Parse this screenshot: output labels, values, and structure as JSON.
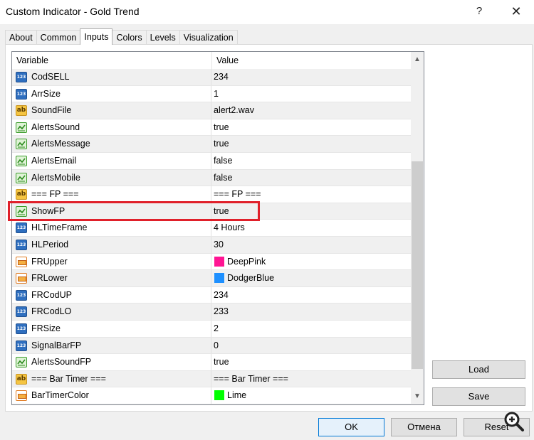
{
  "window": {
    "title": "Custom Indicator - Gold Trend",
    "help": "?",
    "close": "✕"
  },
  "tabs": [
    "About",
    "Common",
    "Inputs",
    "Colors",
    "Levels",
    "Visualization"
  ],
  "grid": {
    "headers": {
      "variable": "Variable",
      "value": "Value"
    },
    "rows": [
      {
        "type": "num",
        "name": "CodSELL",
        "value": "234"
      },
      {
        "type": "num",
        "name": "ArrSize",
        "value": "1"
      },
      {
        "type": "str",
        "name": "SoundFile",
        "value": "alert2.wav"
      },
      {
        "type": "bool",
        "name": "AlertsSound",
        "value": "true"
      },
      {
        "type": "bool",
        "name": "AlertsMessage",
        "value": "true"
      },
      {
        "type": "bool",
        "name": "AlertsEmail",
        "value": "false"
      },
      {
        "type": "bool",
        "name": "AlertsMobile",
        "value": "false"
      },
      {
        "type": "str",
        "name": "=== FP ===",
        "value": "=== FP ==="
      },
      {
        "type": "bool",
        "name": "ShowFP",
        "value": "true"
      },
      {
        "type": "num",
        "name": "HLTimeFrame",
        "value": "4 Hours"
      },
      {
        "type": "num",
        "name": "HLPeriod",
        "value": "30"
      },
      {
        "type": "color",
        "name": "FRUpper",
        "value": "DeepPink",
        "swatch": "#ff1493"
      },
      {
        "type": "color",
        "name": "FRLower",
        "value": "DodgerBlue",
        "swatch": "#1e90ff"
      },
      {
        "type": "num",
        "name": "FRCodUP",
        "value": "234"
      },
      {
        "type": "num",
        "name": "FRCodLO",
        "value": "233"
      },
      {
        "type": "num",
        "name": "FRSize",
        "value": "2"
      },
      {
        "type": "num",
        "name": "SignalBarFP",
        "value": "0"
      },
      {
        "type": "bool",
        "name": "AlertsSoundFP",
        "value": "true"
      },
      {
        "type": "str",
        "name": "=== Bar Timer ===",
        "value": "=== Bar Timer ==="
      },
      {
        "type": "color",
        "name": "BarTimerColor",
        "value": "Lime",
        "swatch": "#00ff00"
      }
    ]
  },
  "buttons": {
    "load": "Load",
    "save": "Save",
    "ok": "OK",
    "cancel": "Отмена",
    "reset": "Reset"
  },
  "icon_labels": {
    "num": "123",
    "str": "ab"
  },
  "colors": {
    "highlight": "#e0202a",
    "ok_border": "#0078d7"
  }
}
